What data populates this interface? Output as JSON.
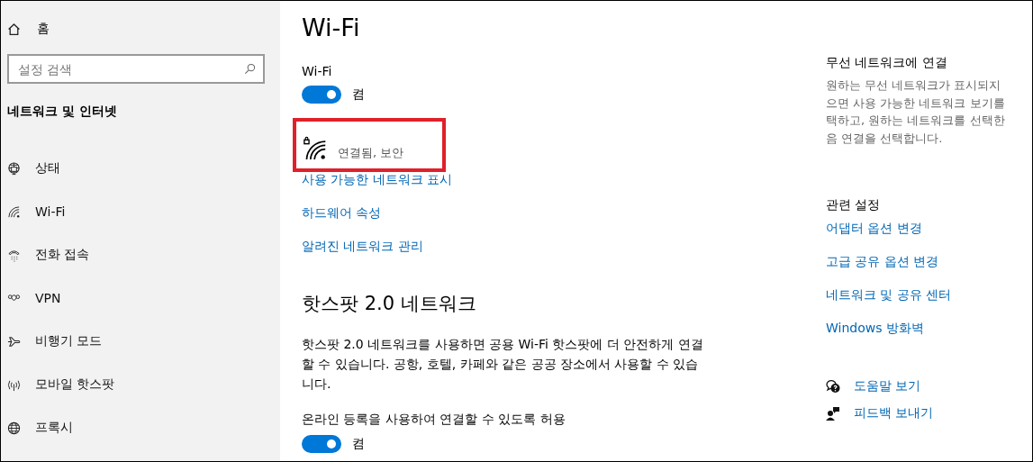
{
  "sidebar": {
    "home": "홈",
    "search": {
      "placeholder": "설정 검색"
    },
    "heading": "네트워크 및 인터넷",
    "items": [
      {
        "kind": "status",
        "label": "상태"
      },
      {
        "kind": "wifi",
        "label": "Wi-Fi"
      },
      {
        "kind": "dialup",
        "label": "전화 접속"
      },
      {
        "kind": "vpn",
        "label": "VPN"
      },
      {
        "kind": "airplane",
        "label": "비행기 모드"
      },
      {
        "kind": "hotspot",
        "label": "모바일 핫스팟"
      },
      {
        "kind": "proxy",
        "label": "프록시"
      }
    ]
  },
  "main": {
    "title": "Wi-Fi",
    "wifi_label": "Wi-Fi",
    "wifi_toggle": {
      "on": true,
      "label": "켬"
    },
    "network": {
      "status": "연결됨, 보안"
    },
    "links": [
      "사용 가능한 네트워크 표시",
      "하드웨어 속성",
      "알려진 네트워크 관리"
    ],
    "hotspot": {
      "heading": "핫스팟 2.0 네트워크",
      "description": "핫스팟 2.0 네트워크를 사용하면 공용 Wi-Fi 핫스팟에 더 안전하게 연결할 수 있습니다. 공항, 호텔, 카페와 같은 공공 장소에서 사용할 수 있습니다.",
      "option_label": "온라인 등록을 사용하여 연결할 수 있도록 허용",
      "toggle": {
        "on": true,
        "label": "켬"
      }
    }
  },
  "aside": {
    "connect_title": "무선 네트워크에 연결",
    "connect_lines": [
      "원하는 무선 네트워크가 표시되지",
      "으면 사용 가능한 네트워크 보기를",
      "택하고, 원하는 네트워크를 선택한",
      "음 연결을 선택합니다."
    ],
    "related_title": "관련 설정",
    "related_links": [
      "어댑터 옵션 변경",
      "고급 공유 옵션 변경",
      "네트워크 및 공유 센터",
      "Windows 방화벽"
    ],
    "help": [
      {
        "kind": "help",
        "label": "도움말 보기"
      },
      {
        "kind": "feedback",
        "label": "피드백 보내기"
      }
    ]
  }
}
